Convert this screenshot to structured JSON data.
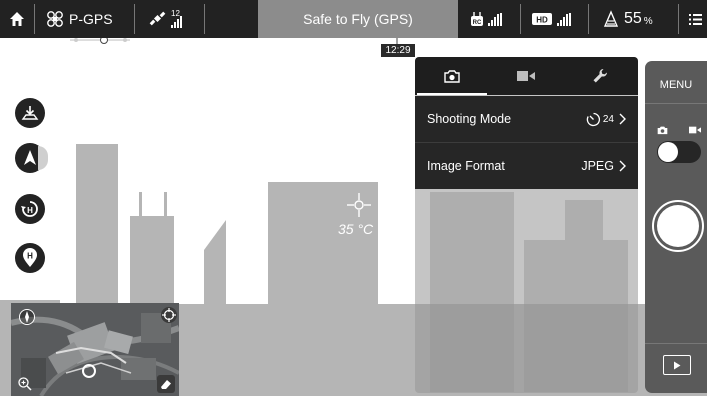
{
  "topbar": {
    "flight_mode": "P-GPS",
    "satellite_count": "12",
    "status": "Safe to Fly (GPS)",
    "battery_value": "55",
    "battery_unit": "%",
    "rc_label": "RC",
    "hd_label": "HD",
    "icons": [
      "home-icon",
      "aircraft-icon",
      "satellite-icon",
      "remote-controller-icon",
      "hd-video-link-icon",
      "battery-icon",
      "menu-icon"
    ]
  },
  "timeline": {
    "time": "12:29"
  },
  "scene": {
    "temperature": "35 °C"
  },
  "left_buttons": [
    "takeoff-icon",
    "navigation-arrow-icon",
    "return-home-icon",
    "home-point-icon"
  ],
  "minimap": {
    "icons": [
      "compass-icon",
      "locate-icon",
      "zoom-icon",
      "eraser-icon"
    ]
  },
  "camera_panel": {
    "tabs": [
      {
        "name": "photo",
        "icon": "camera-icon"
      },
      {
        "name": "video",
        "icon": "video-icon"
      },
      {
        "name": "settings",
        "icon": "wrench-icon"
      }
    ],
    "rows": [
      {
        "label": "Shooting Mode",
        "value": "24",
        "icon": "timer-icon"
      },
      {
        "label": "Image Format",
        "value": "JPEG"
      }
    ]
  },
  "camera_bar": {
    "menu_label": "MENU",
    "mode": "photo",
    "icons": [
      "camera-icon",
      "video-icon",
      "shutter-icon",
      "playback-icon"
    ]
  },
  "colors": {
    "topbar": "#222222",
    "status_center": "#8c8c8c",
    "building": "#b5b5b5",
    "panel_dark": "#262626"
  }
}
